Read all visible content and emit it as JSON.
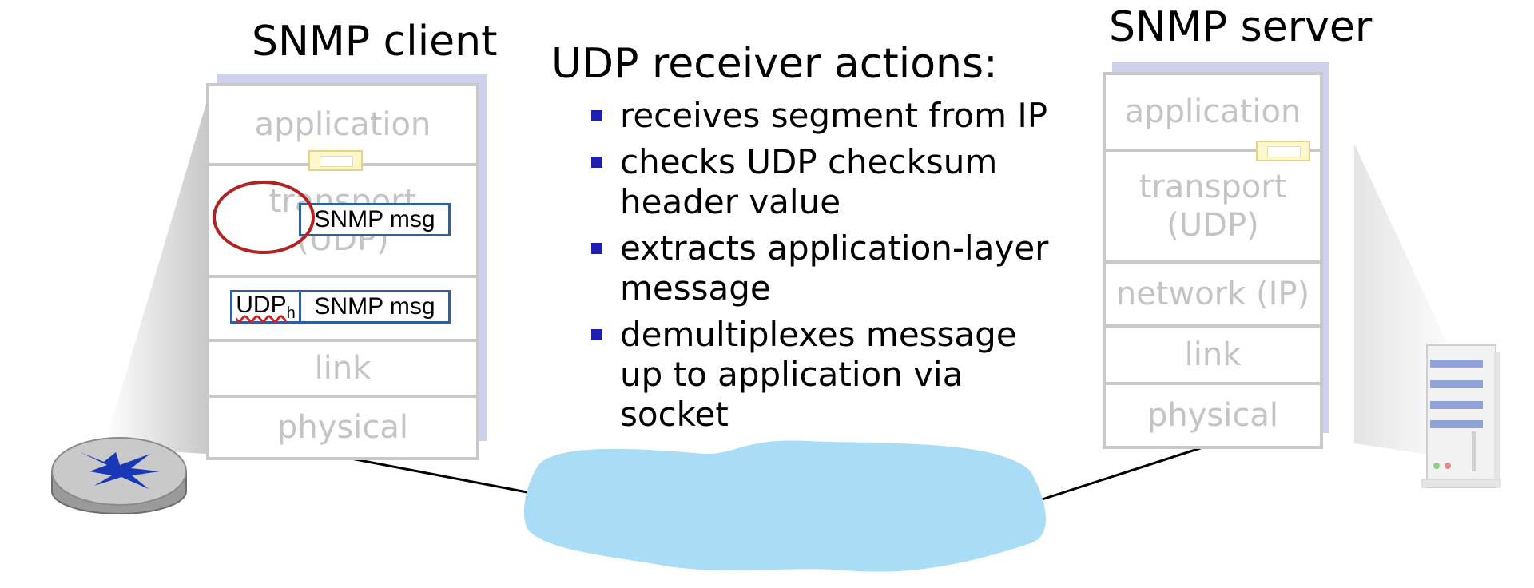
{
  "client": {
    "title": "SNMP client",
    "layers": [
      "application",
      "transport (UDP)",
      "",
      "link",
      "physical"
    ],
    "msg_transport": "SNMP msg",
    "msg_network": "SNMP msg",
    "udp_header": "UDP",
    "udp_header_sub": "h"
  },
  "server": {
    "title": "SNMP server",
    "layers": [
      "application",
      "transport (UDP)",
      "network (IP)",
      "link",
      "physical"
    ]
  },
  "actions": {
    "title": "UDP receiver actions:",
    "items": [
      "receives segment from IP",
      "checks UDP checksum header value",
      "extracts application-layer message",
      "demultiplexes message up to application via socket"
    ]
  },
  "colors": {
    "bullet": "#1f1fb3",
    "network_cloud": "#a9dcf5",
    "circle": "#b22222",
    "msg_border": "#2f5fa0",
    "stack_shadow": "#cdd0ea",
    "layer_text": "#c4c4c4"
  },
  "icons": [
    "router-icon",
    "server-icon",
    "socket-icon",
    "network-cloud",
    "highlight-circle"
  ]
}
